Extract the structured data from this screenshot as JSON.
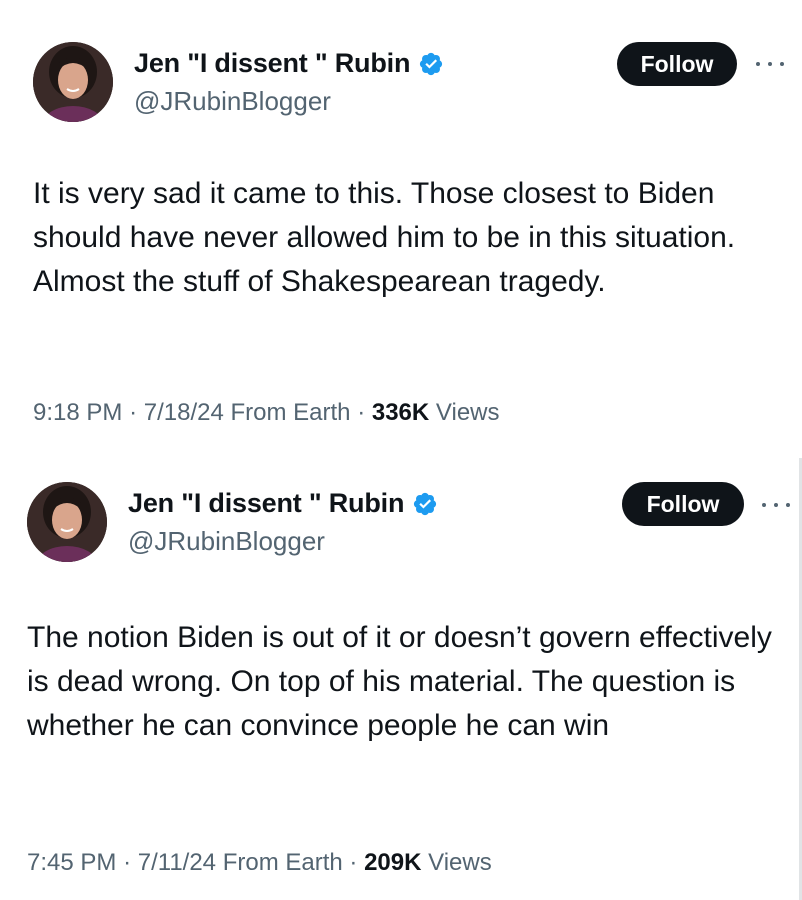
{
  "tweets": [
    {
      "author": {
        "display_name": "Jen \"I dissent \" Rubin",
        "handle": "@JRubinBlogger",
        "verified": true
      },
      "follow_label": "Follow",
      "more_icon": "more-horizontal-icon",
      "text": "It is very sad it came to this. Those closest to Biden should have never allowed him to be in this situation. Almost the stuff of Shakespearean tragedy.",
      "time": "9:18 PM",
      "date": "7/18/24",
      "source": "From Earth",
      "separator": "·",
      "views_count": "336K",
      "views_label": "Views"
    },
    {
      "author": {
        "display_name": "Jen \"I dissent \" Rubin",
        "handle": "@JRubinBlogger",
        "verified": true
      },
      "follow_label": "Follow",
      "more_icon": "more-horizontal-icon",
      "text": "The notion Biden is out of it or doesn’t govern effectively is dead wrong. On top of his material. The question is whether he can convince people he can win",
      "time": "7:45 PM",
      "date": "7/11/24",
      "source": "From Earth",
      "separator": "·",
      "views_count": "209K",
      "views_label": "Views"
    }
  ],
  "colors": {
    "text_primary": "#0f1419",
    "text_secondary": "#536471",
    "verified_blue": "#1d9bf0",
    "follow_bg": "#0f1419",
    "follow_text": "#ffffff"
  }
}
